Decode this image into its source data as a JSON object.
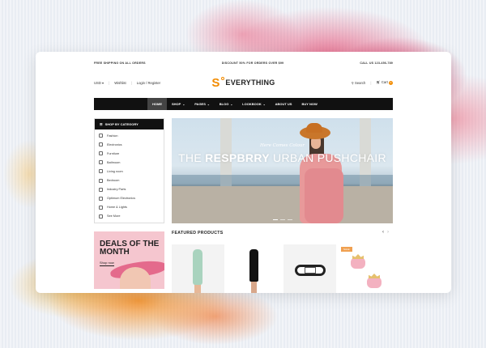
{
  "topbar": {
    "shipping": "FREE SHIPPING ON ALL ORDERS",
    "discount": "DISCOUNT 50% FOR ORDERS OVER $99",
    "phone": "CALL US 123-456-789"
  },
  "header": {
    "currency": "USD",
    "wishlist": "Wishlist",
    "login": "Login / Register",
    "logo_mark": "S",
    "logo_text": "EVERYTHING",
    "search": "Search",
    "cart": "Cart",
    "cart_count": "0"
  },
  "nav": {
    "items": [
      {
        "label": "HOME",
        "has_menu": false
      },
      {
        "label": "SHOP",
        "has_menu": true
      },
      {
        "label": "PAGES",
        "has_menu": true
      },
      {
        "label": "BLOG",
        "has_menu": true
      },
      {
        "label": "LOOKBOOK",
        "has_menu": true
      },
      {
        "label": "ABOUT US",
        "has_menu": false
      },
      {
        "label": "BUY NOW",
        "has_menu": false
      }
    ]
  },
  "sidebar": {
    "title": "SHOP BY CATEGORY",
    "items": [
      {
        "label": "Fashion",
        "icon": "hanger-icon"
      },
      {
        "label": "Electronics",
        "icon": "phone-icon"
      },
      {
        "label": "Furniture",
        "icon": "sofa-icon"
      },
      {
        "label": "Bathroom",
        "icon": "bath-icon"
      },
      {
        "label": "Living room",
        "icon": "lamp-icon"
      },
      {
        "label": "Bedroom",
        "icon": "bed-icon"
      },
      {
        "label": "Industry Parts",
        "icon": "gear-icon"
      },
      {
        "label": "Optimum Electronics",
        "icon": "monitor-icon"
      },
      {
        "label": "Home & Lights",
        "icon": "bulb-icon"
      },
      {
        "label": "See More",
        "icon": "plus-icon"
      }
    ]
  },
  "hero": {
    "tagline": "Here Comes Colour",
    "title_prefix": "THE ",
    "title_bold": "RESPBRRY",
    "title_suffix": " URBAN PUSHCHAIR"
  },
  "deals": {
    "title_line1": "DEALS OF THE",
    "title_line2": "MONTH",
    "button": "Shop now"
  },
  "featured": {
    "title": "FEATURED PRODUCTS",
    "sale_badge": "SALE"
  },
  "colors": {
    "accent": "#f28b00",
    "nav_bg": "#111111",
    "deals_bg": "#f5c6cf"
  }
}
